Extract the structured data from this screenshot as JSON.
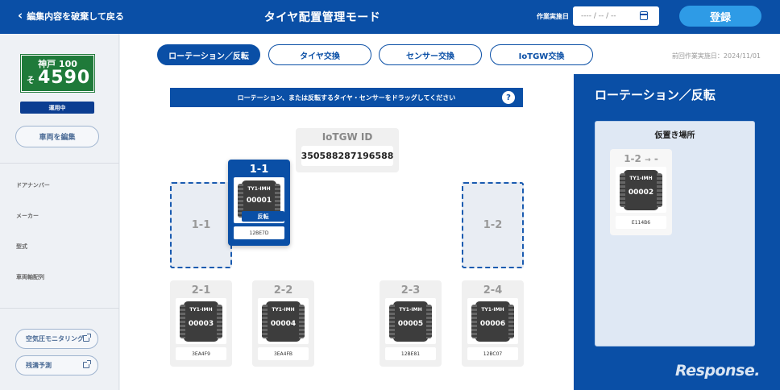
{
  "header": {
    "back_label": "編集内容を破棄して戻る",
    "title": "タイヤ配置管理モード",
    "date_label": "作業実施日",
    "date_placeholder": "---- / -- / --",
    "register_label": "登録"
  },
  "sidebar": {
    "plate": {
      "region": "神戸 100",
      "kana": "そ",
      "number": "4590",
      "color": "#1f7a3a"
    },
    "status_badge": "運用中",
    "edit_vehicle_label": "車両を編集",
    "fields": [
      "ドアナンバー",
      "メーカー",
      "型式",
      "車両軸配列"
    ],
    "link_buttons": [
      "空気圧モニタリング",
      "残溝予測"
    ]
  },
  "tabs": [
    {
      "label": "ローテーション／反転",
      "active": true
    },
    {
      "label": "タイヤ交換",
      "active": false
    },
    {
      "label": "センサー交換",
      "active": false
    },
    {
      "label": "IoTGW交換",
      "active": false
    }
  ],
  "last_work_date": "前回作業実施日：2024/11/01",
  "main": {
    "banner": "ローテーション、または反転するタイヤ・センサーをドラッグしてください",
    "help_icon": "?",
    "iotgw": {
      "label": "IoTGW ID",
      "value": "350588287196588"
    },
    "empty_slots": [
      {
        "label": "1-1"
      },
      {
        "label": "1-2"
      }
    ],
    "selected_card": {
      "position": "1-1",
      "tire_model": "TY1-IMH",
      "tire_no": "00001",
      "badge": "反転",
      "sensor_id": "12BE7D"
    },
    "cards": [
      {
        "position": "2-1",
        "tire_model": "TY1-IMH",
        "tire_no": "00003",
        "sensor_id": "3EA4F9"
      },
      {
        "position": "2-2",
        "tire_model": "TY1-IMH",
        "tire_no": "00004",
        "sensor_id": "3EA4FB"
      },
      {
        "position": "2-3",
        "tire_model": "TY1-IMH",
        "tire_no": "00005",
        "sensor_id": "12BE81"
      },
      {
        "position": "2-4",
        "tire_model": "TY1-IMH",
        "tire_no": "00006",
        "sensor_id": "12BC07"
      }
    ]
  },
  "right_panel": {
    "title": "ローテーション／反転",
    "temp_area_label": "仮置き場所",
    "card": {
      "from": "1-2",
      "arrow": "→",
      "to": "-",
      "tire_model": "TY1-IMH",
      "tire_no": "00002",
      "sensor_id": "E114B6"
    }
  },
  "watermark": "Response."
}
